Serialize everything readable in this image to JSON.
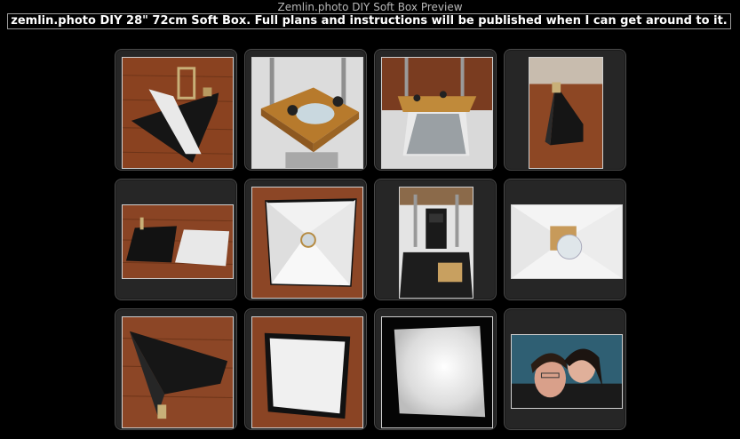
{
  "page": {
    "title": "Zemlin.photo DIY Soft Box Preview",
    "banner": "zemlin.photo DIY 28\" 72cm Soft Box. Full plans and instructions will be published when I can get around to it."
  },
  "gallery": {
    "thumbnails": [
      {
        "row": 1,
        "col": 1,
        "subject": "folded black panel with white fabric and hinge on wood floor"
      },
      {
        "row": 1,
        "col": 2,
        "subject": "plywood speed ring mount with threaded rods"
      },
      {
        "row": 1,
        "col": 3,
        "subject": "speed ring mount on metal cone reflector"
      },
      {
        "row": 1,
        "col": 4,
        "subject": "black folded panel standing on wood floor"
      },
      {
        "row": 2,
        "col": 1,
        "subject": "black panel and white diffuser on wood floor"
      },
      {
        "row": 2,
        "col": 2,
        "subject": "soft box interior white pyramid viewed from front"
      },
      {
        "row": 2,
        "col": 3,
        "subject": "flash unit mounted on speed ring"
      },
      {
        "row": 2,
        "col": 4,
        "subject": "white interior corner with mounted flash bulb"
      },
      {
        "row": 3,
        "col": 1,
        "subject": "assembled black soft box pyramid side view"
      },
      {
        "row": 3,
        "col": 2,
        "subject": "soft box front with white diffuser panel"
      },
      {
        "row": 3,
        "col": 3,
        "subject": "lit soft box diffuser glowing"
      },
      {
        "row": 3,
        "col": 4,
        "subject": "two people portrait sample photo"
      }
    ]
  }
}
